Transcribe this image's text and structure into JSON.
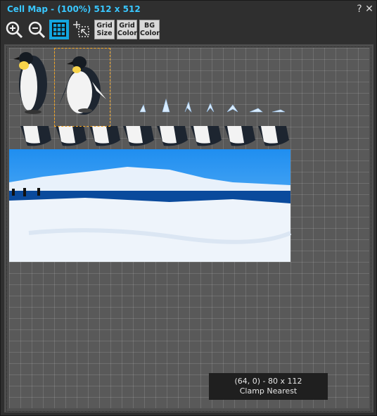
{
  "window": {
    "title": "Cell Map - (100%) 512 x 512",
    "help_label": "?",
    "close_label": "✕"
  },
  "toolbar": {
    "zoom_in_icon": "zoom-in-icon",
    "zoom_out_icon": "zoom-out-icon",
    "grid_toggle_icon": "grid-icon",
    "select_tool_icon": "select-cell-icon",
    "grid_size": {
      "line1": "Grid",
      "line2": "Size"
    },
    "grid_color": {
      "line1": "Grid",
      "line2": "Color"
    },
    "bg_color": {
      "line1": "BG",
      "line2": "Color"
    },
    "active_color": "#13a6e0"
  },
  "canvas": {
    "size": "512 x 512",
    "grid_cell": 16,
    "background": "#595959"
  },
  "selection": {
    "color": "#f5a623"
  },
  "status": {
    "cell_info": "(64, 0) - 80 x 112",
    "mode": "Clamp  Nearest"
  }
}
